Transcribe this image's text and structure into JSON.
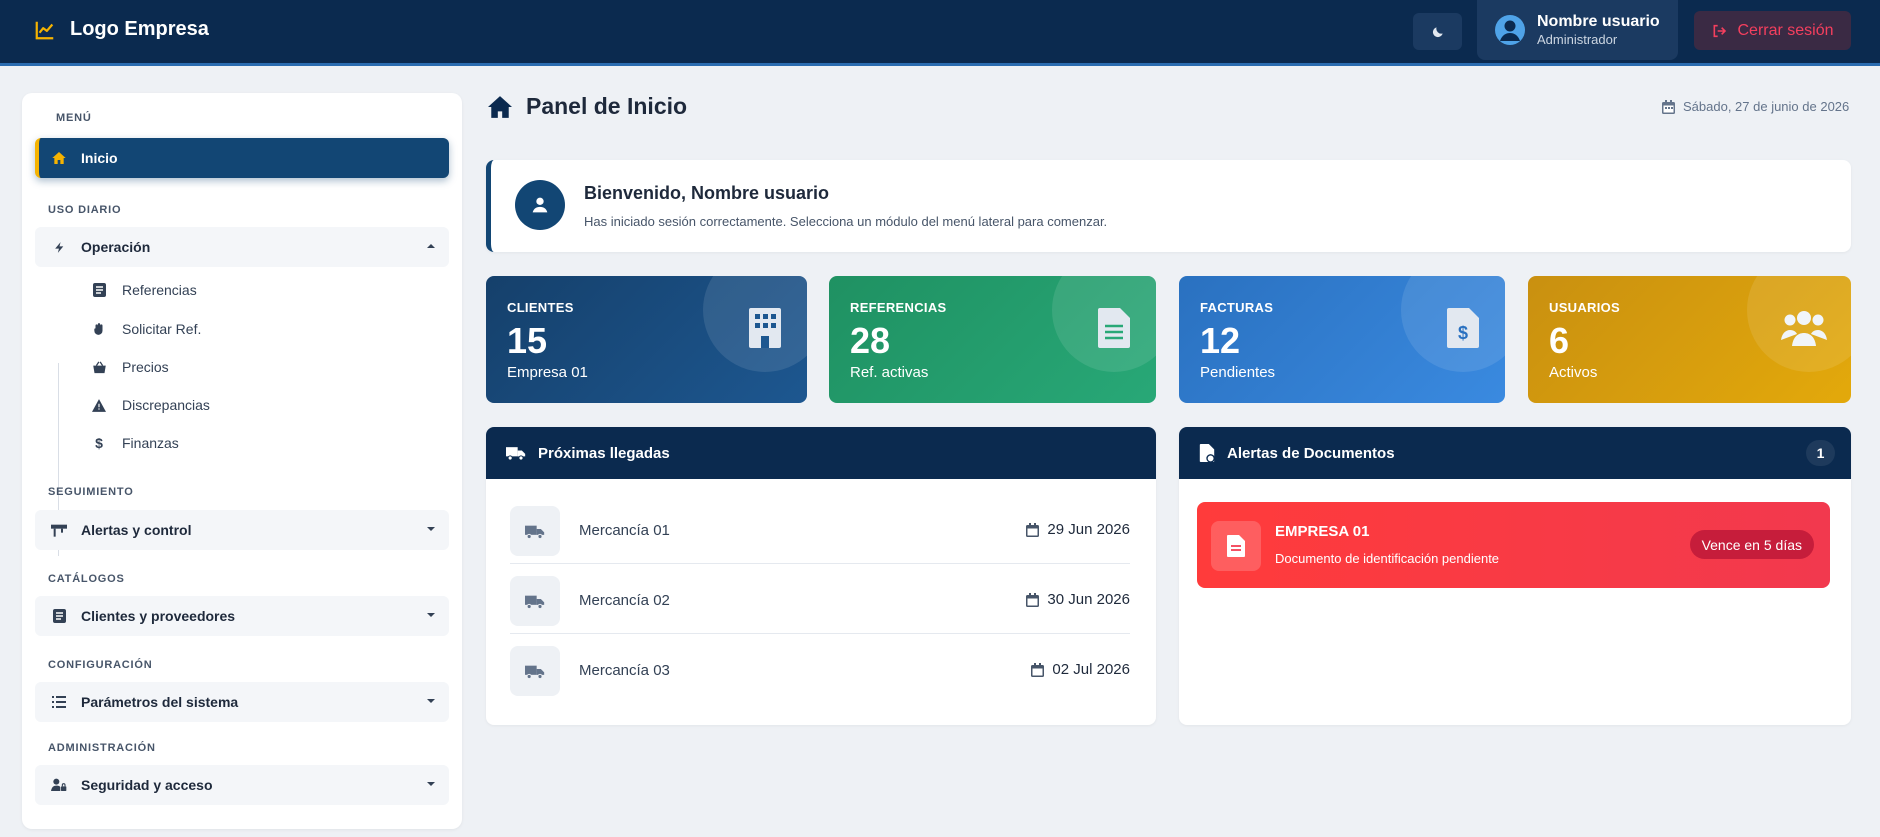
{
  "topbar": {
    "brand": "Logo Empresa",
    "user_name": "Nombre usuario",
    "user_role": "Administrador",
    "logout_label": "Cerrar sesión"
  },
  "sidebar": {
    "menu_title": "MENÚ",
    "inicio": "Inicio",
    "sections": {
      "uso_diario": "USO DIARIO",
      "seguimiento": "SEGUIMIENTO",
      "catalogos": "CATÁLOGOS",
      "configuracion": "CONFIGURACIÓN",
      "administracion": "ADMINISTRACIÓN"
    },
    "operacion": "Operación",
    "operacion_items": [
      "Referencias",
      "Solicitar Ref.",
      "Precios",
      "Discrepancias",
      "Finanzas"
    ],
    "alertas_control": "Alertas y control",
    "clientes_proveedores": "Clientes y proveedores",
    "parametros": "Parámetros del sistema",
    "seguridad": "Seguridad y acceso"
  },
  "main": {
    "page_title": "Panel de Inicio",
    "date": "Sábado, 27 de junio de 2026",
    "welcome_title": "Bienvenido, Nombre usuario",
    "welcome_text": "Has iniciado sesión correctamente. Selecciona un módulo del menú lateral para comenzar.",
    "stats": [
      {
        "label": "CLIENTES",
        "value": "15",
        "sub": "Empresa 01",
        "color": "#15406b"
      },
      {
        "label": "REFERENCIAS",
        "value": "28",
        "sub": "Ref. activas",
        "color": "#1f9162"
      },
      {
        "label": "FACTURAS",
        "value": "12",
        "sub": "Pendientes",
        "color": "#2c78c9"
      },
      {
        "label": "USUARIOS",
        "value": "6",
        "sub": "Activos",
        "color": "#d29a0d"
      }
    ],
    "arrivals": {
      "title": "Próximas llegadas",
      "items": [
        {
          "name": "Mercancía 01",
          "date": "29 Jun 2026"
        },
        {
          "name": "Mercancía 02",
          "date": "30 Jun 2026"
        },
        {
          "name": "Mercancía 03",
          "date": "02 Jul 2026"
        }
      ]
    },
    "alerts": {
      "title": "Alertas de Documentos",
      "count": "1",
      "items": [
        {
          "company": "EMPRESA 01",
          "description": "Documento de identificación pendiente",
          "badge": "Vence en 5 días"
        }
      ]
    }
  },
  "colors": {
    "navy": "#0b2a4f",
    "accent_gold": "#f5b301",
    "danger": "#f43f5e"
  }
}
